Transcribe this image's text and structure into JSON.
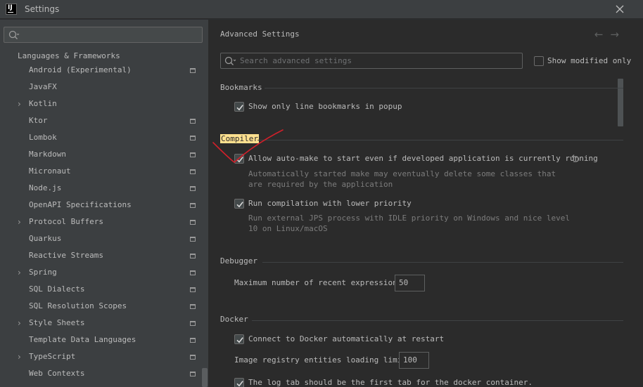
{
  "window": {
    "title": "Settings",
    "logo_text": "IJ"
  },
  "left_panel": {
    "search_placeholder": "",
    "section_title": "Languages & Frameworks",
    "items": [
      {
        "label": "Android (Experimental)",
        "expandable": false,
        "project_icon": true
      },
      {
        "label": "JavaFX",
        "expandable": false,
        "project_icon": false
      },
      {
        "label": "Kotlin",
        "expandable": true,
        "project_icon": false
      },
      {
        "label": "Ktor",
        "expandable": false,
        "project_icon": true
      },
      {
        "label": "Lombok",
        "expandable": false,
        "project_icon": true
      },
      {
        "label": "Markdown",
        "expandable": false,
        "project_icon": true
      },
      {
        "label": "Micronaut",
        "expandable": false,
        "project_icon": true
      },
      {
        "label": "Node.js",
        "expandable": false,
        "project_icon": true
      },
      {
        "label": "OpenAPI Specifications",
        "expandable": false,
        "project_icon": true
      },
      {
        "label": "Protocol Buffers",
        "expandable": true,
        "project_icon": true
      },
      {
        "label": "Quarkus",
        "expandable": false,
        "project_icon": true
      },
      {
        "label": "Reactive Streams",
        "expandable": false,
        "project_icon": true
      },
      {
        "label": "Spring",
        "expandable": true,
        "project_icon": true
      },
      {
        "label": "SQL Dialects",
        "expandable": false,
        "project_icon": true
      },
      {
        "label": "SQL Resolution Scopes",
        "expandable": false,
        "project_icon": true
      },
      {
        "label": "Style Sheets",
        "expandable": true,
        "project_icon": true
      },
      {
        "label": "Template Data Languages",
        "expandable": false,
        "project_icon": true
      },
      {
        "label": "TypeScript",
        "expandable": true,
        "project_icon": true
      },
      {
        "label": "Web Contexts",
        "expandable": false,
        "project_icon": true
      }
    ]
  },
  "right_panel": {
    "title": "Advanced Settings",
    "search_placeholder": "Search advanced settings",
    "show_modified_label": "Show modified only",
    "show_modified_checked": false,
    "sections": {
      "bookmarks": {
        "title": "Bookmarks",
        "option": {
          "label": "Show only line bookmarks in popup",
          "checked": true
        }
      },
      "compiler": {
        "title": "Compiler",
        "auto_make": {
          "label": "Allow auto-make to start even if developed application is currently running",
          "checked": true,
          "desc_line1": "Automatically started make may eventually delete some classes that",
          "desc_line2": "are required by the application"
        },
        "low_priority": {
          "label": "Run compilation with lower priority",
          "checked": true,
          "desc_line1": "Run external JPS process with IDLE priority on Windows and nice level",
          "desc_line2": "10 on Linux/macOS"
        }
      },
      "debugger": {
        "title": "Debugger",
        "max_expr_label": "Maximum number of recent expressions:",
        "max_expr_value": "50"
      },
      "docker": {
        "title": "Docker",
        "connect": {
          "label": "Connect to Docker automatically at restart",
          "checked": true
        },
        "registry_label": "Image registry entities loading limit:",
        "registry_value": "100",
        "log_tab": {
          "label": "The log tab should be the first tab for the docker container.",
          "checked": true
        }
      }
    }
  },
  "colors": {
    "highlight": "#fee08f",
    "annotation_red": "#d0202a"
  }
}
